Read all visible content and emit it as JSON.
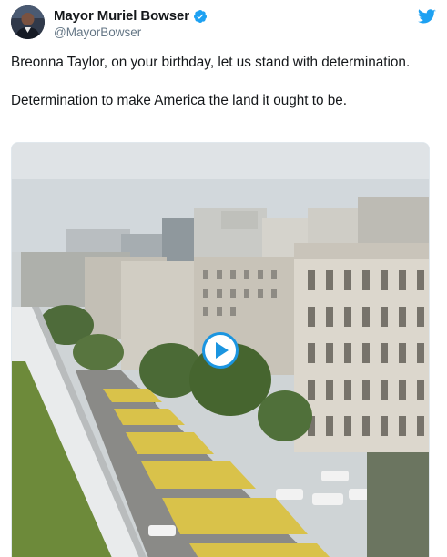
{
  "author": {
    "display_name": "Mayor Muriel Bowser",
    "handle": "@MayorBowser",
    "verified": true,
    "avatar_icon": "profile-photo"
  },
  "tweet": {
    "line1": "Breonna Taylor, on your birthday, let us stand with determination.",
    "line2": "Determination to make America the land it ought to be."
  },
  "media": {
    "type": "video",
    "play_icon": "play-icon",
    "description_icon": "aerial-street-scene"
  },
  "colors": {
    "twitter_blue": "#1da1f2",
    "play_blue": "#1b95e0",
    "text": "#14171a",
    "secondary_text": "#657786"
  }
}
